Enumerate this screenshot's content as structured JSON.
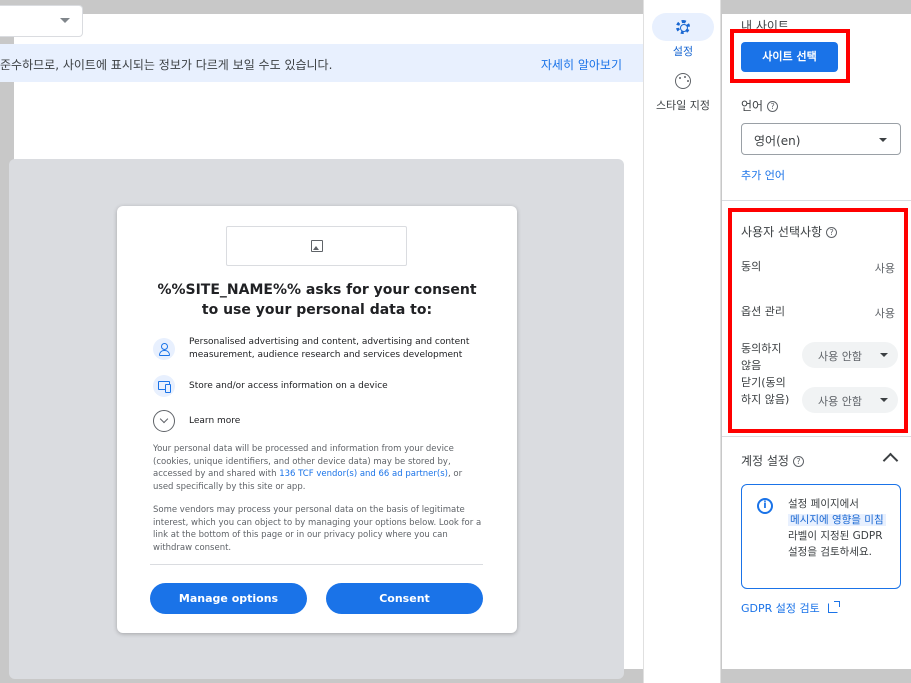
{
  "top": {
    "banner_text": "준수하므로, 사이트에 표시되는 정보가 다르게 보일 수도 있습니다.",
    "banner_link": "자세히 알아보기"
  },
  "consent_dialog": {
    "title": "%%SITE_NAME%% asks for your consent to use your personal data to:",
    "purposes": [
      {
        "icon": "person-icon",
        "text": "Personalised advertising and content, advertising and content measurement, audience research and services development"
      },
      {
        "icon": "device-icon",
        "text": "Store and/or access information on a device"
      }
    ],
    "learn_more": "Learn more",
    "para1_before": "Your personal data will be processed and information from your device (cookies, unique identifiers, and other device data) may be stored by, accessed by and shared with ",
    "para1_link": "136 TCF vendor(s) and 66 ad partner(s)",
    "para1_after": ", or used specifically by this site or app.",
    "para2": "Some vendors may process your personal data on the basis of legitimate interest, which you can object to by managing your options below. Look for a link at the bottom of this page or in our privacy policy where you can withdraw consent.",
    "manage_button": "Manage options",
    "consent_button": "Consent"
  },
  "rail": {
    "settings_label": "설정",
    "style_label": "스타일 지정"
  },
  "panel": {
    "my_sites_label": "내 사이트",
    "site_select_button": "사이트 선택",
    "language_label": "언어",
    "language_value": "영어(en)",
    "add_language": "추가 언어",
    "user_choices_label": "사용자 선택사항",
    "choices": [
      {
        "label": "동의",
        "value": "사용"
      },
      {
        "label": "옵션 관리",
        "value": "사용"
      },
      {
        "label": "동의하지 않음",
        "value": "사용 안함"
      },
      {
        "label": "닫기(동의하지 않음)",
        "value": "사용 안함"
      }
    ],
    "account_settings_label": "계정 설정",
    "info_text_before": "설정 페이지에서",
    "info_text_highlight": "메시지에 영향을 미침",
    "info_text_after": "라벨이 지정된 GDPR 설정을 검토하세요.",
    "gdpr_link": "GDPR 설정 검토"
  },
  "colors": {
    "accent": "#1a73e8",
    "highlight_box": "#ff0000"
  }
}
